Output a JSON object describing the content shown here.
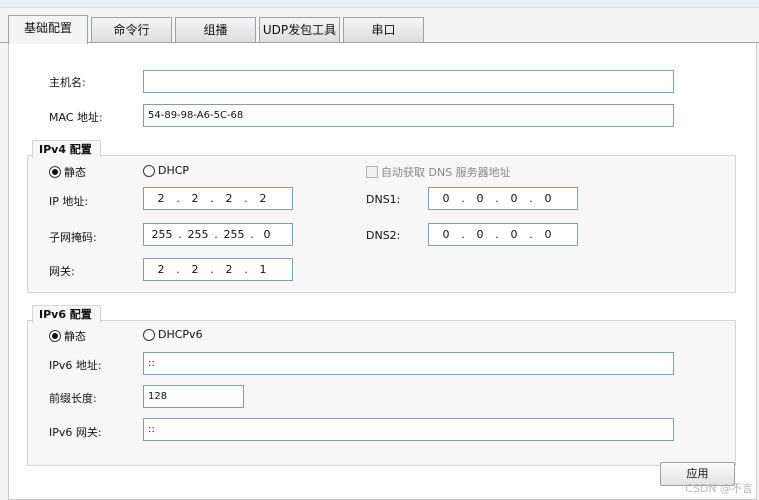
{
  "tabs": [
    {
      "label": "基础配置",
      "active": true
    },
    {
      "label": "命令行",
      "active": false
    },
    {
      "label": "组播",
      "active": false
    },
    {
      "label": "UDP发包工具",
      "active": false
    },
    {
      "label": "串口",
      "active": false
    }
  ],
  "basic": {
    "hostname_label": "主机名:",
    "hostname_value": "",
    "mac_label": "MAC 地址:",
    "mac_value": "54-89-98-A6-5C-68"
  },
  "ipv4": {
    "title": "IPv4 配置",
    "static_label": "静态",
    "dhcp_label": "DHCP",
    "auto_dns_label": "自动获取 DNS 服务器地址",
    "ip_label": "IP 地址:",
    "ip": [
      "2",
      "2",
      "2",
      "2"
    ],
    "mask_label": "子网掩码:",
    "mask": [
      "255",
      "255",
      "255",
      "0"
    ],
    "gateway_label": "网关:",
    "gateway": [
      "2",
      "2",
      "2",
      "1"
    ],
    "dns1_label": "DNS1:",
    "dns1": [
      "0",
      "0",
      "0",
      "0"
    ],
    "dns2_label": "DNS2:",
    "dns2": [
      "0",
      "0",
      "0",
      "0"
    ]
  },
  "ipv6": {
    "title": "IPv6 配置",
    "static_label": "静态",
    "dhcp_label": "DHCPv6",
    "ip_label": "IPv6 地址:",
    "ip_value": "::",
    "prefix_label": "前缀长度:",
    "prefix_value": "128",
    "gateway_label": "IPv6 网关:",
    "gateway_value": "::"
  },
  "apply_label": "应用",
  "watermark": "CSDN @不言"
}
